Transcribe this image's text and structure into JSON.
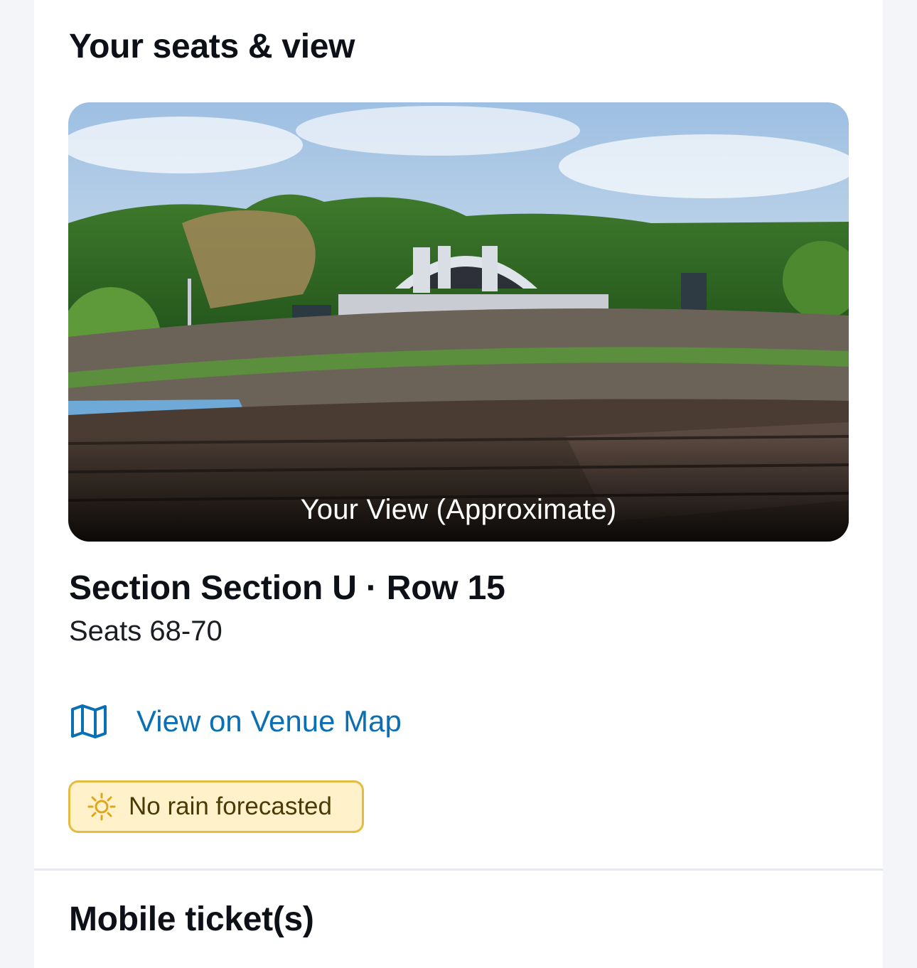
{
  "seats_section": {
    "title": "Your seats & view",
    "view_caption": "Your View (Approximate)",
    "seat_title": "Section Section U · Row 15",
    "seats": "Seats 68-70"
  },
  "venue_map": {
    "label": "View on Venue Map",
    "icon": "map-icon"
  },
  "weather": {
    "label": "No rain forecasted",
    "icon": "sun-icon"
  },
  "mobile_tickets": {
    "title": "Mobile ticket(s)"
  },
  "colors": {
    "link": "#0a6fb3",
    "badge_bg": "#fff1c9",
    "badge_border": "#e6bb43"
  }
}
